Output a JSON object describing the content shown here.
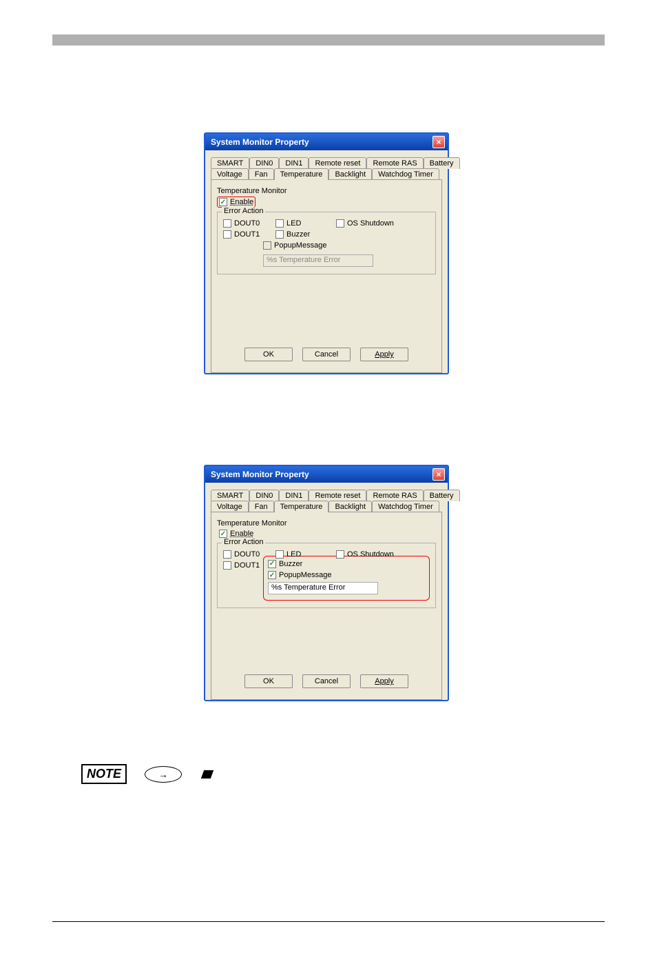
{
  "dialog": {
    "title": "System Monitor Property",
    "tabs_row1": [
      "SMART",
      "DIN0",
      "DIN1",
      "Remote reset",
      "Remote RAS",
      "Battery"
    ],
    "tabs_row2": [
      "Voltage",
      "Fan",
      "Temperature",
      "Backlight",
      "Watchdog Timer"
    ],
    "active_tab": "Temperature",
    "monitor_label": "Temperature Monitor",
    "enable_label": "Enable",
    "error_action_label": "Error Action",
    "checks": {
      "dout0": "DOUT0",
      "dout1": "DOUT1",
      "led": "LED",
      "os_shutdown": "OS Shutdown",
      "buzzer": "Buzzer",
      "popup": "PopupMessage"
    },
    "popup_text": "%s Temperature Error",
    "buttons": {
      "ok": "OK",
      "cancel": "Cancel",
      "apply": "Apply"
    }
  },
  "note_label": "NOTE"
}
